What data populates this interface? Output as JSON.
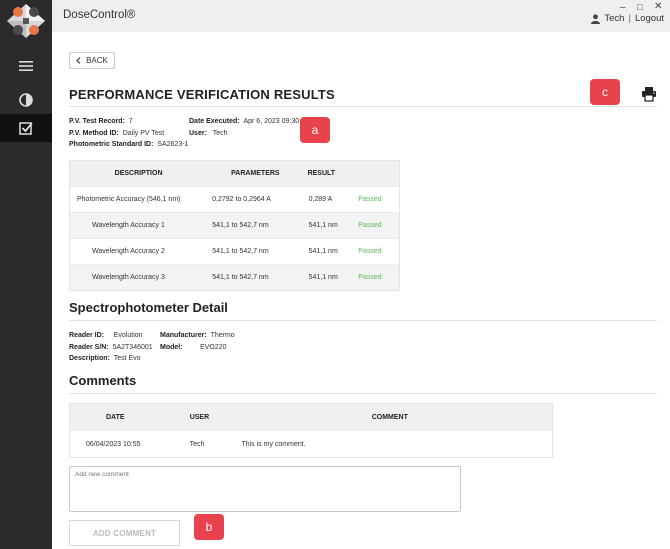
{
  "app": {
    "title": "DoseControl®"
  },
  "window_controls": {
    "minimize": "–",
    "maximize": "□",
    "close": "✕"
  },
  "user": {
    "name": "Tech",
    "separator": "|",
    "logout": "Logout",
    "icon": "person-icon"
  },
  "sidebar": {
    "items": [
      {
        "icon": "menu-icon",
        "active": false
      },
      {
        "icon": "pie-chart-icon",
        "active": false
      },
      {
        "icon": "checkbox-icon",
        "active": true
      }
    ]
  },
  "back_label": "BACK",
  "page_title": "PERFORMANCE VERIFICATION RESULTS",
  "markers": {
    "a": "a",
    "b": "b",
    "c": "c"
  },
  "record": {
    "test_record_label": "P.V. Test Record:",
    "test_record_value": "7",
    "method_label": "P.V. Method ID:",
    "method_value": "Daily PV Test",
    "standard_label": "Photometric Standard ID:",
    "standard_value": "SA2623-1",
    "date_label": "Date Executed:",
    "date_value": "Apr 6, 2023 09:30",
    "user_label": "User:",
    "user_value": "Tech"
  },
  "results": {
    "headers": [
      "DESCRIPTION",
      "PARAMETERS",
      "RESULT",
      ""
    ],
    "rows": [
      {
        "description": "Photometric Accuracy (546,1 nm)",
        "parameters": "0,2792 to 0,2964 A",
        "result": "0,289 A",
        "status": "Passed"
      },
      {
        "description": "Wavelength Accuracy 1",
        "parameters": "541,1 to 542,7  nm",
        "result": "541,1 nm",
        "status": "Passed"
      },
      {
        "description": "Wavelength Accuracy 2",
        "parameters": "541,1 to 542,7  nm",
        "result": "541,1 nm",
        "status": "Passed"
      },
      {
        "description": "Wavelength Accuracy 3",
        "parameters": "541,1 to 542,7  nm",
        "result": "541,1 nm",
        "status": "Passed"
      }
    ]
  },
  "spectro": {
    "title": "Spectrophotometer Detail",
    "reader_id_label": "Reader ID:",
    "reader_id_value": "Evolution",
    "reader_sn_label": "Reader S/N:",
    "reader_sn_value": "5A2T346001",
    "description_label": "Description:",
    "description_value": "Test Evo",
    "manufacturer_label": "Manufacturer:",
    "manufacturer_value": "Thermo",
    "model_label": "Model:",
    "model_value": "EVO220"
  },
  "comments": {
    "title": "Comments",
    "headers": [
      "DATE",
      "USER",
      "COMMENT"
    ],
    "rows": [
      {
        "date": "06/04/2023 10:55",
        "user": "Tech",
        "comment": "This is my comment."
      }
    ],
    "placeholder": "Add new comment",
    "add_label": "ADD COMMENT"
  },
  "colors": {
    "sidebar": "#2b2b2b",
    "marker": "#e8424d",
    "passed": "#5bb85b"
  }
}
